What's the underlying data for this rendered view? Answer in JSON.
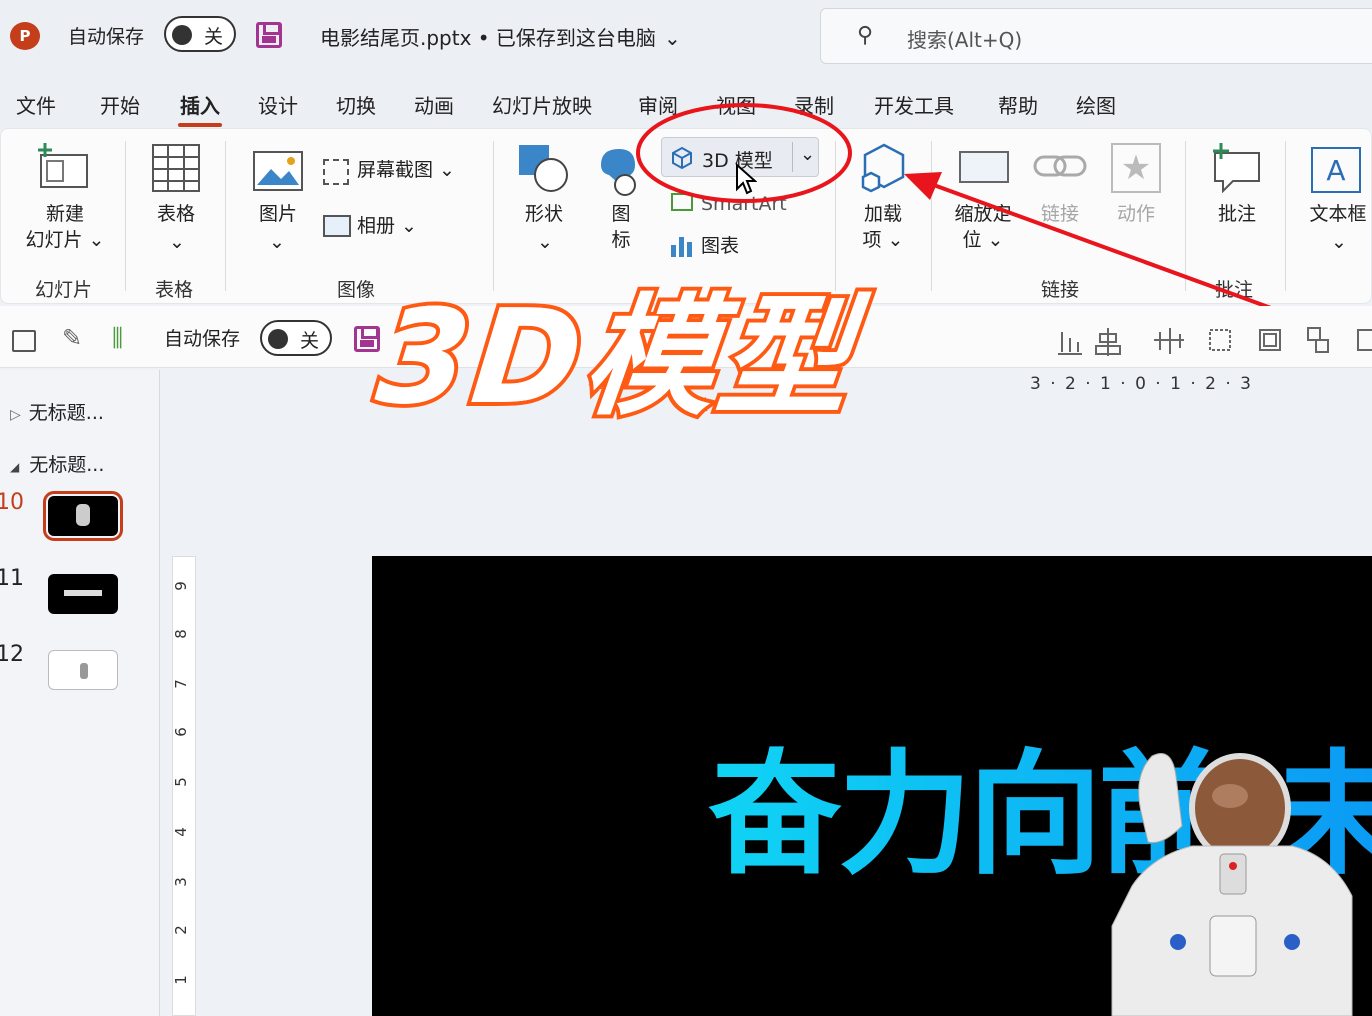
{
  "titlebar": {
    "app_logo": "P",
    "autosave_label": "自动保存",
    "autosave_state": "关",
    "document_title": "电影结尾页.pptx • 已保存到这台电脑",
    "search_placeholder": "搜索(Alt+Q)"
  },
  "menu": {
    "tabs": [
      "文件",
      "开始",
      "插入",
      "设计",
      "切换",
      "动画",
      "幻灯片放映",
      "审阅",
      "视图",
      "录制",
      "开发工具",
      "帮助",
      "绘图"
    ],
    "active_tab": "插入"
  },
  "ribbon": {
    "new_slide": "新建\n幻灯片 ⌄",
    "group_slides": "幻灯片",
    "table": "表格",
    "group_table": "表格",
    "picture": "图片",
    "screenshot": "屏幕截图 ⌄",
    "album": "相册  ⌄",
    "group_images": "图像",
    "shapes": "形状",
    "icons": "图\n标",
    "model3d": "3D 模型",
    "smartart": "SmartArt",
    "chart": "图表",
    "addins": "加载\n项 ⌄",
    "zoom": "缩放定\n位 ⌄",
    "link": "链接",
    "action": "动作",
    "group_links": "链接",
    "comment": "批注",
    "group_comments": "批注",
    "textbox": "文本框",
    "accent_color": "#c43e1c",
    "annotation_color": "#e8151c"
  },
  "qat": {
    "autosave_label": "自动保存",
    "autosave_state": "关"
  },
  "left_panel": {
    "sections": [
      "无标题...",
      "无标题..."
    ],
    "slide_numbers": [
      "10",
      "11",
      "12"
    ]
  },
  "ruler": {
    "horizontal": "3 · 2 · 1 · 0 · 1 · 2 · 3",
    "vertical": [
      "9",
      "8",
      "7",
      "6",
      "5",
      "4",
      "3",
      "2",
      "1"
    ]
  },
  "slide": {
    "headline": "奋力向前 未来"
  },
  "overlay": {
    "banner": "3D模型"
  }
}
